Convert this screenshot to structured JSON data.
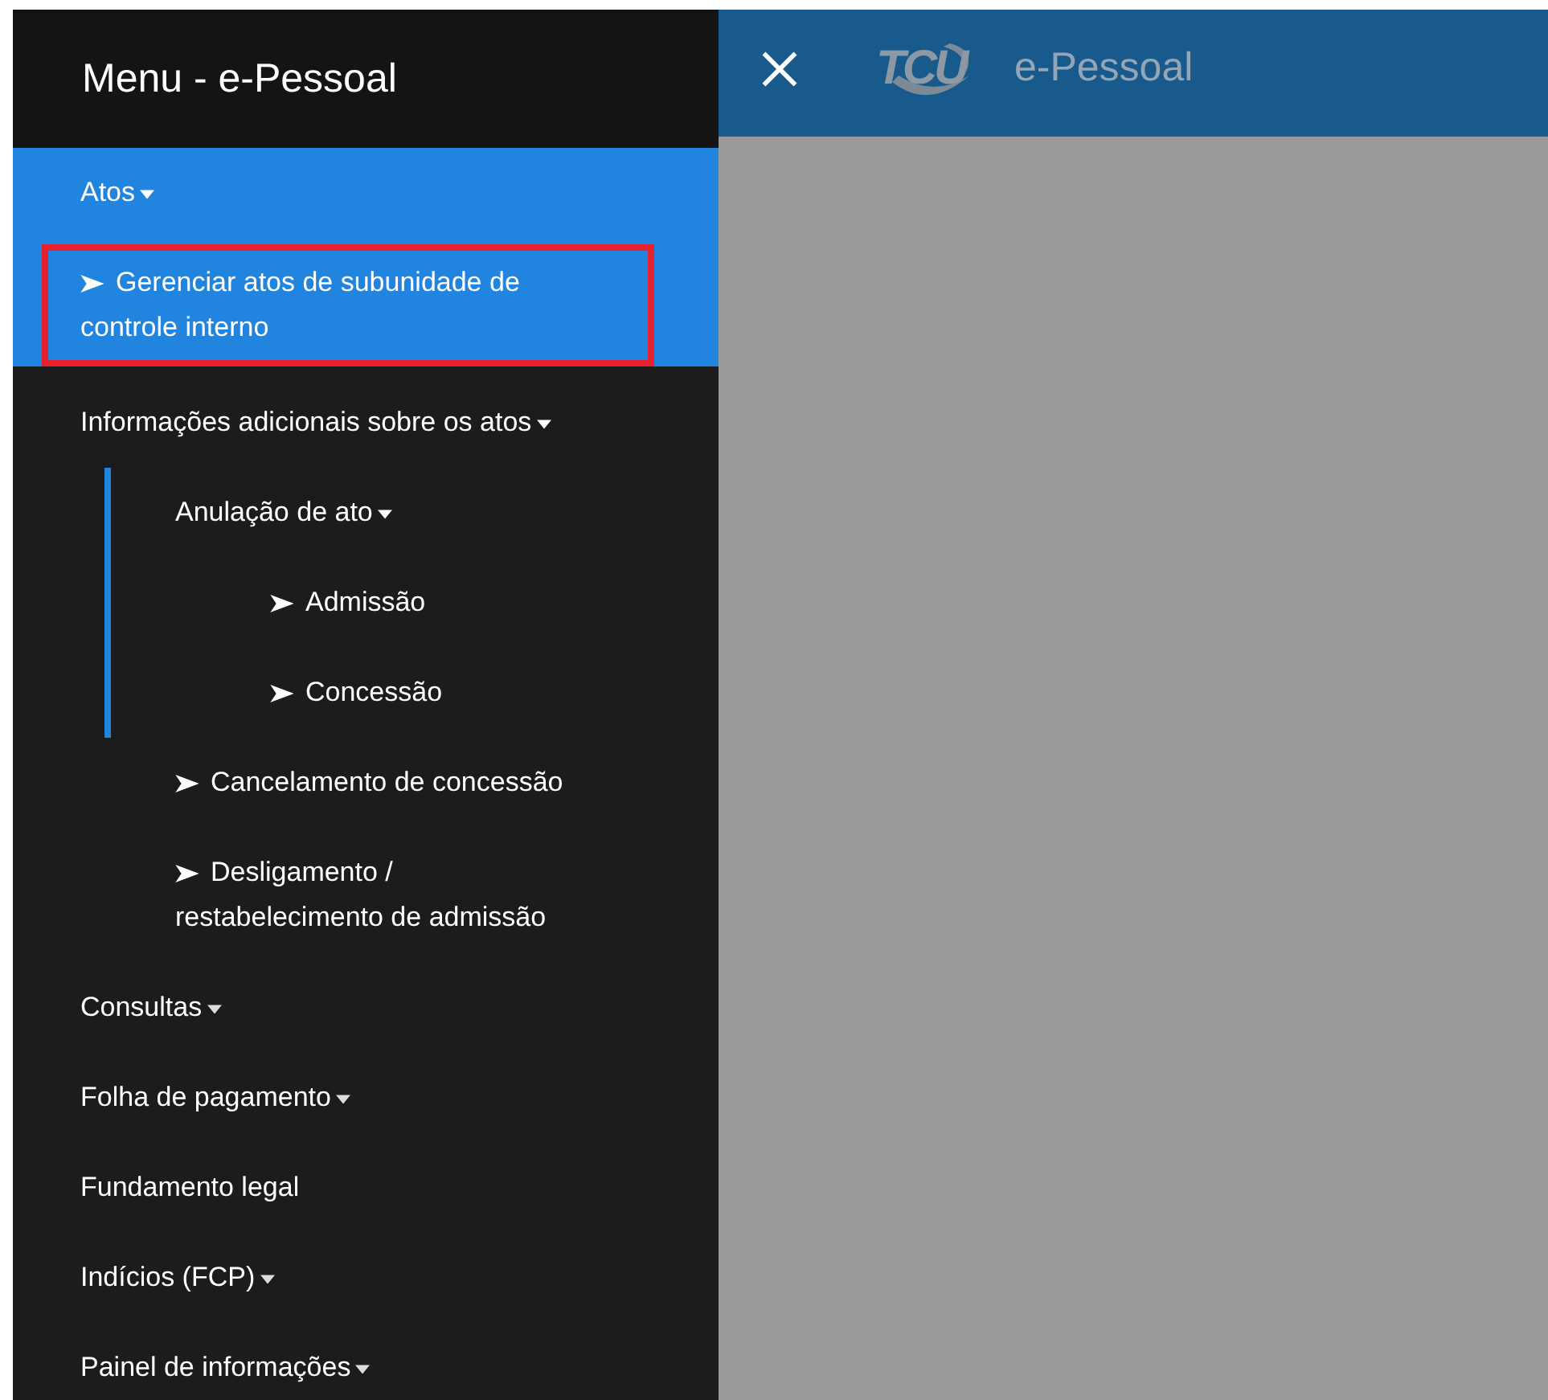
{
  "sidebar": {
    "title": "Menu - e-Pessoal",
    "items": [
      {
        "kind": "group",
        "label": "Atos",
        "expanded": true,
        "selected": true,
        "children": [
          {
            "kind": "link",
            "label": "Gerenciar atos de subunidade de controle interno",
            "outlined": true
          }
        ]
      },
      {
        "kind": "group",
        "label": "Informações adicionais sobre os atos",
        "expanded": true,
        "selected": false,
        "children": [
          {
            "kind": "group",
            "label": "Anulação de ato",
            "expanded": true,
            "in_focus": true,
            "children": [
              {
                "kind": "link",
                "label": "Admissão",
                "outlined": false
              },
              {
                "kind": "link",
                "label": "Concessão",
                "outlined": false
              }
            ]
          },
          {
            "kind": "link",
            "label": "Cancelamento de concessão",
            "outlined": false
          },
          {
            "kind": "link",
            "label": "Desligamento / restabelecimento de admissão",
            "outlined": false
          }
        ]
      },
      {
        "kind": "group",
        "label": "Consultas",
        "expanded": false,
        "selected": false
      },
      {
        "kind": "group",
        "label": "Folha de pagamento",
        "expanded": false,
        "selected": false
      },
      {
        "kind": "item",
        "label": "Fundamento legal"
      },
      {
        "kind": "group",
        "label": "Indícios (FCP)",
        "expanded": false,
        "selected": false
      },
      {
        "kind": "group",
        "label": "Painel de informações",
        "expanded": false,
        "selected": false
      }
    ]
  },
  "header": {
    "logo": "TCU",
    "app_name": "e-Pessoal"
  }
}
